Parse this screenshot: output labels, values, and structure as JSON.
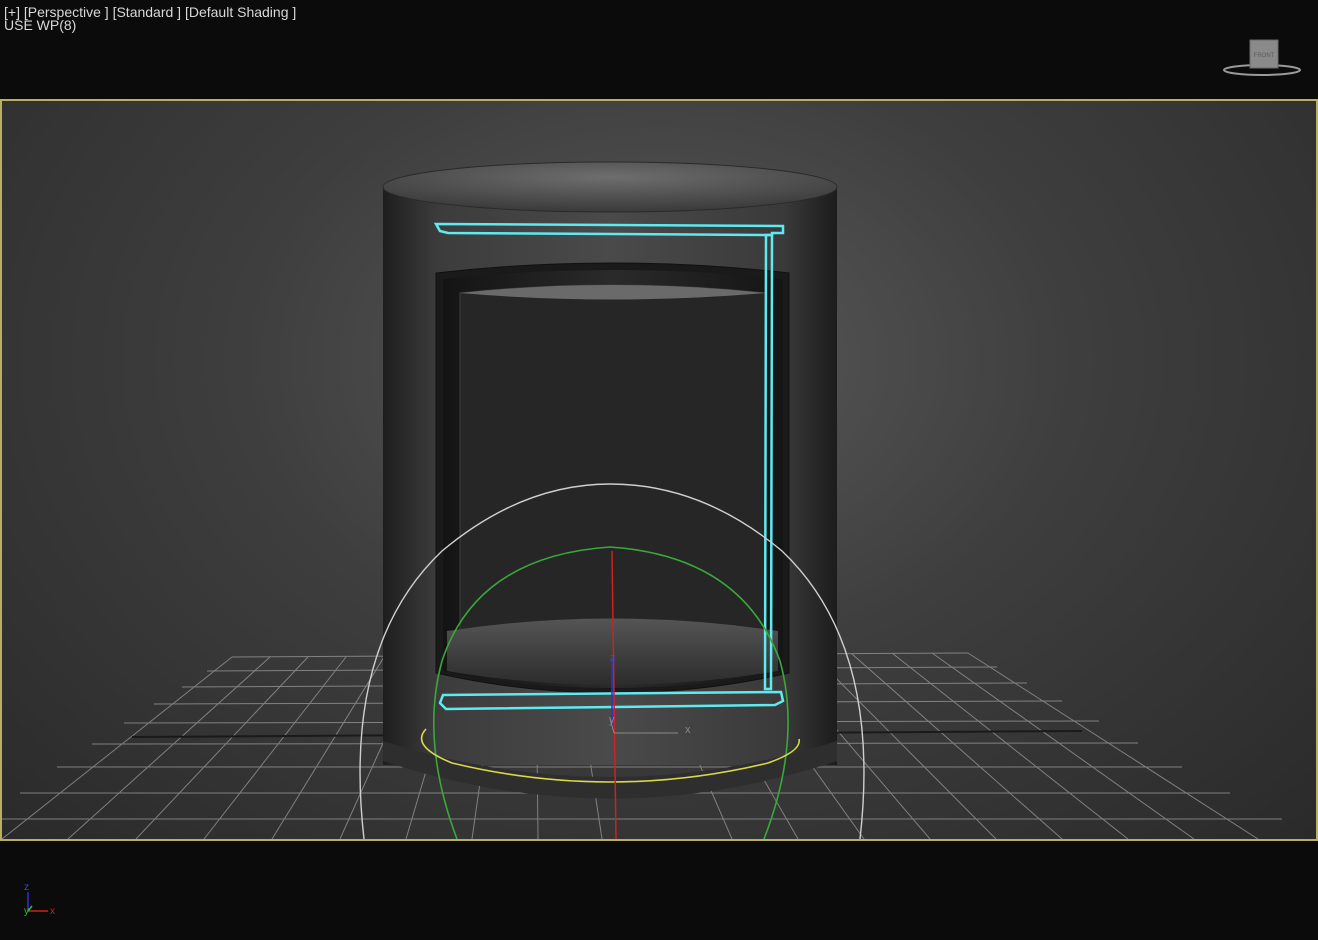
{
  "viewport_label": {
    "plus": "[+]",
    "view": "[Perspective ]",
    "renderer": "[Standard ]",
    "shading": "[Default Shading ]",
    "status": "USE WP(8)"
  },
  "viewcube": {
    "face_label": "FRONT"
  },
  "gizmo": {
    "z_label": "z",
    "y_label": "y",
    "x_label": "x"
  },
  "axis_tripod": {
    "z_label": "z",
    "y_label": "y",
    "x_label": "x"
  },
  "colors": {
    "viewport_border": "#b8b060",
    "selection": "#5fe9f0",
    "gizmo_outer": "#cfcfcf",
    "gizmo_green": "#3aa83a",
    "gizmo_yellow": "#d8d84a",
    "axis_red": "#d02020",
    "axis_blue": "#3030d0",
    "axis_green": "#30c030"
  }
}
